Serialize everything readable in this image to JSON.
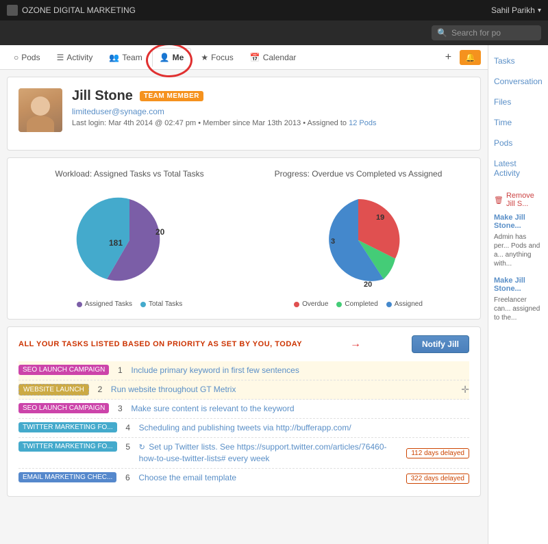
{
  "app": {
    "title": "OZONE DIGITAL MARKETING",
    "user": "Sahil Parikh",
    "search_placeholder": "Search for po"
  },
  "nav_tabs": [
    {
      "label": "Pods",
      "icon": "○",
      "active": false
    },
    {
      "label": "Activity",
      "icon": "☰",
      "active": false
    },
    {
      "label": "Team",
      "icon": "👥",
      "active": false
    },
    {
      "label": "Me",
      "icon": "👤",
      "active": true
    },
    {
      "label": "Focus",
      "icon": "★",
      "active": false
    },
    {
      "label": "Calendar",
      "icon": "📅",
      "active": false
    }
  ],
  "profile": {
    "name": "Jill Stone",
    "badge": "TEAM MEMBER",
    "email": "limiteduser@synage.com",
    "meta": "Last login: Mar 4th 2014 @ 02:47 pm • Member since Mar 13th 2013 • Assigned to 12 Pods",
    "pods_count": "12 Pods"
  },
  "workload_chart": {
    "title": "Workload: Assigned Tasks vs Total Tasks",
    "legend": [
      {
        "label": "Assigned Tasks",
        "color": "#7b5ea7"
      },
      {
        "label": "Total Tasks",
        "color": "#44aacc"
      }
    ],
    "labels": {
      "assigned": "181",
      "total": "20"
    }
  },
  "progress_chart": {
    "title": "Progress: Overdue vs Completed vs Assigned",
    "legend": [
      {
        "label": "Overdue",
        "color": "#e05050"
      },
      {
        "label": "Completed",
        "color": "#44cc77"
      },
      {
        "label": "Assigned",
        "color": "#4488cc"
      }
    ],
    "labels": {
      "overdue": "19",
      "completed": "3",
      "assigned": "20"
    }
  },
  "tasks_section": {
    "title": "ALL YOUR TASKS LISTED BASED ON PRIORITY AS SET BY YOU, TODAY",
    "notify_btn": "Notify Jill",
    "tasks": [
      {
        "pod": "SEO LAUNCH CAMPAIGN",
        "pod_color": "#cc44aa",
        "num": "1",
        "desc": "Include primary keyword in first few sentences",
        "delay": "",
        "highlighted": true,
        "repeat": false
      },
      {
        "pod": "WEBSITE LAUNCH",
        "pod_color": "#ccaa44",
        "num": "2",
        "desc": "Run website throughout GT Metrix",
        "delay": "",
        "highlighted": true,
        "repeat": false
      },
      {
        "pod": "SEO LAUNCH CAMPAIGN",
        "pod_color": "#cc44aa",
        "num": "3",
        "desc": "Make sure content is relevant to the keyword",
        "delay": "",
        "highlighted": false,
        "repeat": false
      },
      {
        "pod": "TWITTER MARKETING FO...",
        "pod_color": "#44aacc",
        "num": "4",
        "desc": "Scheduling and publishing tweets via http://bufferapp.com/",
        "delay": "",
        "highlighted": false,
        "repeat": false
      },
      {
        "pod": "TWITTER MARKETING FO...",
        "pod_color": "#44aacc",
        "num": "5",
        "desc": "Set up Twitter lists. See https://support.twitter.com/articles/76460-how-to-use-twitter-lists# every week",
        "delay": "112 days delayed",
        "highlighted": false,
        "repeat": true
      },
      {
        "pod": "EMAIL MARKETING CHEC...",
        "pod_color": "#5588cc",
        "num": "6",
        "desc": "Choose the email template",
        "delay": "322 days delayed",
        "highlighted": false,
        "repeat": false
      }
    ]
  },
  "sidebar": {
    "links": [
      "Tasks",
      "Conversation",
      "Files",
      "Time",
      "Pods",
      "Latest Activity"
    ],
    "remove_label": "Remove Jill S...",
    "make_label_1": "Make Jill Stone...",
    "make_desc_1": "Admin has per... Pods and a... anything with...",
    "make_label_2": "Make Jill Stone...",
    "make_desc_2": "Freelancer can... assigned to the..."
  }
}
